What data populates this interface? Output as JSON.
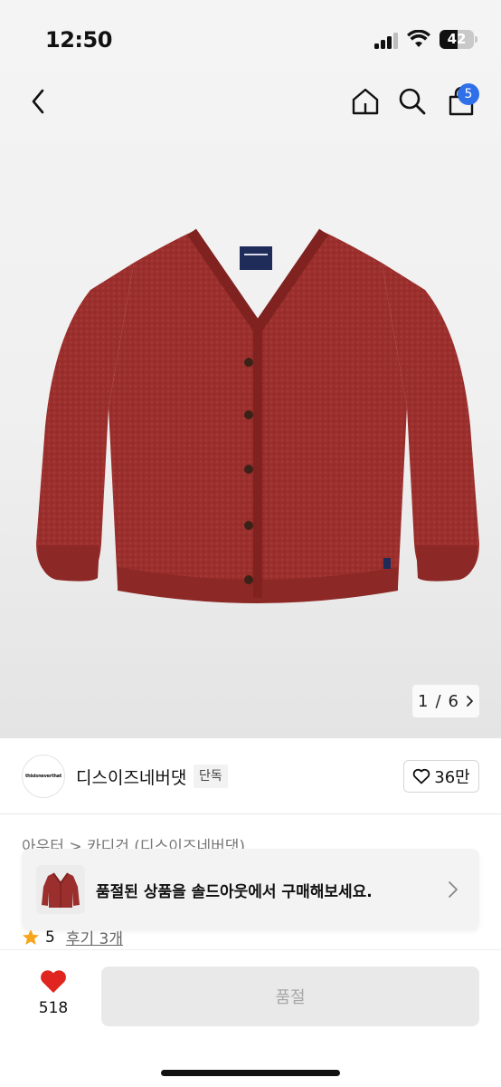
{
  "status_bar": {
    "time": "12:50",
    "battery": "42"
  },
  "header": {
    "cart_count": "5"
  },
  "gallery": {
    "current": "1",
    "separator": "/",
    "total": "6"
  },
  "seller": {
    "logo_text": "thisisneverthat",
    "name": "디스이즈네버댓",
    "badge": "단독",
    "likes": "36만"
  },
  "product": {
    "category_path": "아우터 > 카디건 (디스이즈네버댓)",
    "rating": "5",
    "reviews": "후기 3개"
  },
  "toast": {
    "message": "품절된 상품을 솔드아웃에서 구매해보세요."
  },
  "bottom_bar": {
    "like_count": "518",
    "cta_label": "품절"
  },
  "colors": {
    "accent_blue": "#2f6fe8",
    "heart_red": "#e0241f",
    "star": "#f7a51c",
    "cardigan": "#9b2f2d"
  }
}
